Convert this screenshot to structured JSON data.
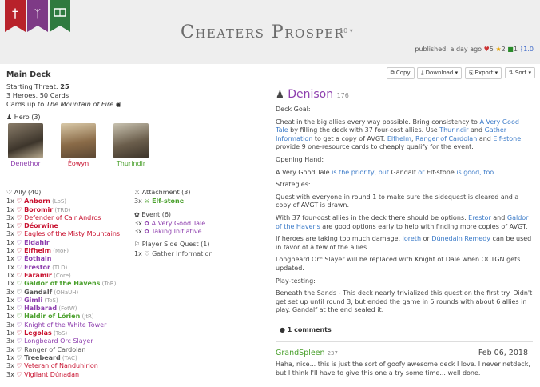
{
  "header": {
    "title": "Cheaters Prosper",
    "count": "10 ▾",
    "published": "published: a day ago",
    "likes": "5",
    "favorites": "2",
    "comments": "1",
    "version": "1.0"
  },
  "banners": [
    {
      "name": "leadership-banner",
      "color": "#b8222a",
      "glyph": "ᚦ"
    },
    {
      "name": "spirit-banner",
      "color": "#7e3a86",
      "glyph": "ᛉ"
    },
    {
      "name": "lore-banner",
      "color": "#2f7a3f",
      "glyph": "☗"
    }
  ],
  "deck": {
    "heading": "Main Deck",
    "threat_label": "Starting Threat:",
    "threat": "25",
    "stats": "3 Heroes, 50 Cards",
    "cards_up_to": "Cards up to",
    "set": "The Mountain of Fire",
    "hero_header": "Hero (3)"
  },
  "heroes": [
    {
      "name": "Denethor",
      "color": "#8e3fae"
    },
    {
      "name": "Éowyn",
      "color": "#c8102e"
    },
    {
      "name": "Thurindir",
      "color": "#4aa02c"
    }
  ],
  "ally": {
    "header": "Ally (40)",
    "rows": [
      {
        "q": "1x",
        "name": "Anborn",
        "set": "(LoS)",
        "cls": "cr",
        "bold": true
      },
      {
        "q": "1x",
        "name": "Boromir",
        "set": "(TRD)",
        "cls": "cr",
        "bold": true
      },
      {
        "q": "3x",
        "name": "Defender of Cair Andros",
        "set": "",
        "cls": "cr",
        "bold": false
      },
      {
        "q": "1x",
        "name": "Déorwine",
        "set": "",
        "cls": "cr",
        "bold": true
      },
      {
        "q": "3x",
        "name": "Eagles of the Misty Mountains",
        "set": "",
        "cls": "cr",
        "bold": false
      },
      {
        "q": "1x",
        "name": "Eldahir",
        "set": "",
        "cls": "cs",
        "bold": true
      },
      {
        "q": "1x",
        "name": "Elfhelm",
        "set": "(MoF)",
        "cls": "cr",
        "bold": true
      },
      {
        "q": "1x",
        "name": "Éothain",
        "set": "",
        "cls": "cs",
        "bold": true
      },
      {
        "q": "1x",
        "name": "Erestor",
        "set": "(TLD)",
        "cls": "cs",
        "bold": true
      },
      {
        "q": "1x",
        "name": "Faramir",
        "set": "(Core)",
        "cls": "cr",
        "bold": true
      },
      {
        "q": "1x",
        "name": "Galdor of the Havens",
        "set": "(ToR)",
        "cls": "cl",
        "bold": true
      },
      {
        "q": "3x",
        "name": "Gandalf",
        "set": "(OHaUH)",
        "cls": "cn",
        "bold": true
      },
      {
        "q": "1x",
        "name": "Gimli",
        "set": "(ToS)",
        "cls": "cs",
        "bold": true
      },
      {
        "q": "1x",
        "name": "Halbarad",
        "set": "(FotW)",
        "cls": "cs",
        "bold": true
      },
      {
        "q": "1x",
        "name": "Haldir of Lórien",
        "set": "(JtR)",
        "cls": "cl",
        "bold": true
      },
      {
        "q": "3x",
        "name": "Knight of the White Tower",
        "set": "",
        "cls": "cs",
        "bold": false
      },
      {
        "q": "1x",
        "name": "Legolas",
        "set": "(ToS)",
        "cls": "cr",
        "bold": true
      },
      {
        "q": "3x",
        "name": "Longbeard Orc Slayer",
        "set": "",
        "cls": "cs",
        "bold": false
      },
      {
        "q": "3x",
        "name": "Ranger of Cardolan",
        "set": "",
        "cls": "cn",
        "bold": false
      },
      {
        "q": "1x",
        "name": "Treebeard",
        "set": "(TAC)",
        "cls": "cn",
        "bold": true
      },
      {
        "q": "3x",
        "name": "Veteran of Nanduhirion",
        "set": "",
        "cls": "cr",
        "bold": false
      },
      {
        "q": "3x",
        "name": "Vigilant Dúnadan",
        "set": "",
        "cls": "cr",
        "bold": false
      }
    ]
  },
  "attachment": {
    "header": "Attachment (3)",
    "rows": [
      {
        "q": "3x",
        "name": "Elf-stone",
        "cls": "cl",
        "bold": true
      }
    ]
  },
  "event": {
    "header": "Event (6)",
    "rows": [
      {
        "q": "3x",
        "name": "A Very Good Tale",
        "cls": "cs",
        "bold": false
      },
      {
        "q": "3x",
        "name": "Taking Initiative",
        "cls": "cs",
        "bold": false
      }
    ]
  },
  "side": {
    "header": "Player Side Quest (1)",
    "rows": [
      {
        "q": "1x",
        "name": "Gather Information",
        "cls": "cn",
        "bold": false
      }
    ]
  },
  "buttons": {
    "copy": "Copy",
    "download": "Download ▾",
    "export": "Export ▾",
    "sort": "Sort ▾"
  },
  "author": {
    "name": "Denison",
    "reputation": "176"
  },
  "desc": {
    "goal_label": "Deck Goal:",
    "goal": [
      "Cheat in the big allies every way possible. Bring consistency to ",
      "A Very Good Tale",
      " by filling the deck with 37 four-cost allies. Use ",
      "Thurindir",
      " and ",
      "Gather Information",
      " to get a copy of AVGT. ",
      "Elfhelm",
      ", ",
      "Ranger of Cardolan",
      " and ",
      "Elf-stone",
      " provide 9 one-resource cards to cheaply qualify for the event."
    ],
    "opening_label": "Opening Hand:",
    "opening": [
      "A Very Good Tale",
      " is the priority, but ",
      "Gandalf",
      " or ",
      "Elf-stone",
      " is good, too."
    ],
    "strategies_label": "Strategies:",
    "s1": "Quest with everyone in round 1 to make sure the sidequest is cleared and a copy of AVGT is drawn.",
    "s2": [
      "With 37 four-cost allies in the deck there should be options. ",
      "Erestor",
      " and ",
      "Galdor of the Havens",
      " are good options early to help with finding more copies of AVGT."
    ],
    "s3": [
      "If heroes are taking too much damage, ",
      "Ioreth",
      " or ",
      "Dúnedain Remedy",
      " can be used in favor of a few of the allies."
    ],
    "s4": "Longbeard Orc Slayer will be replaced with Knight of Dale when OCTGN gets updated.",
    "playtest_label": "Play-testing:",
    "playtest": "Beneath the Sands - This deck nearly trivialized this quest on the first try. Didn't get set up until round 3, but ended the game in 5 rounds with about 6 allies in play. Gandalf at the end sealed it."
  },
  "comments": {
    "label": "1 comments",
    "author": "GrandSpleen",
    "rep": "237",
    "date": "Feb 06, 2018",
    "text": "Haha, nice... this is just the sort of goofy awesome deck I love. I never netdeck, but I think I'll have to give this one a try some time... well done."
  }
}
